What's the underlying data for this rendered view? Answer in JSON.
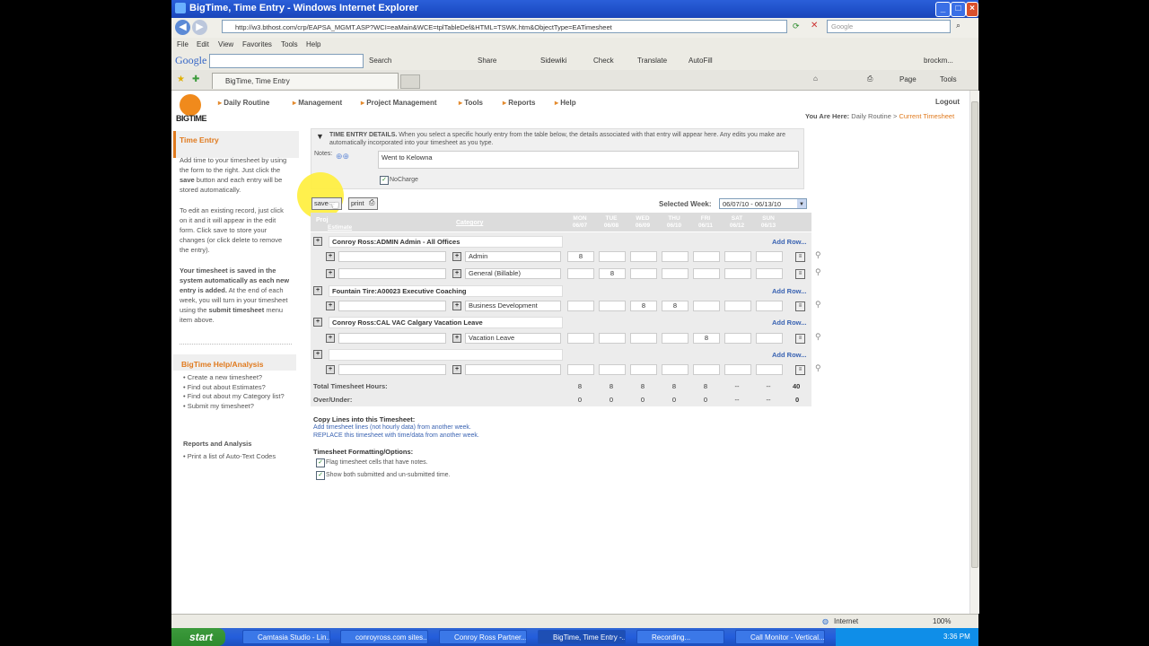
{
  "window": {
    "title": "BigTime, Time Entry - Windows Internet Explorer"
  },
  "browser": {
    "address": "http://w3.bthost.com/crp/EAPSA_MGMT.ASP?WCI=eaMain&WCE=tplTableDef&HTML=TSWK.htm&ObjectType=EATimesheet",
    "search_placeholder": "Google",
    "menu": [
      "File",
      "Edit",
      "View",
      "Favorites",
      "Tools",
      "Help"
    ],
    "google_label": "Google",
    "google_toolbar": [
      "Search",
      "Share",
      "Sidewiki",
      "Check",
      "Translate",
      "AutoFill"
    ],
    "google_user": "brockm...",
    "tab_title": "BigTime, Time Entry",
    "command_bar": [
      "Page",
      "Tools"
    ]
  },
  "app": {
    "logo": "BIGTIME",
    "nav": [
      "Daily Routine",
      "Management",
      "Project Management",
      "Tools",
      "Reports",
      "Help"
    ],
    "logout": "Logout",
    "breadcrumb": {
      "prefix": "You Are Here:",
      "crumb1": "Daily Routine",
      "sep": ">",
      "current": "Current Timesheet"
    }
  },
  "sidebar": {
    "title": "Time Entry",
    "p1a": "Add time to your timesheet by using the form to the right. Just click the",
    "p1b": "save",
    "p1c": "button and each entry will be stored automatically.",
    "p2": "To edit an existing record, just click on it and it will appear in the edit form. Click save to store your changes (or click delete to remove the entry).",
    "p3a": "Your timesheet is saved in the system automatically as each new entry is added.",
    "p3b": "At the end of each week, you will turn in your timesheet using the",
    "p3c": "submit timesheet",
    "p3d": "menu item above.",
    "help_title": "BigTime Help/Analysis",
    "help_links": [
      "Create a new timesheet?",
      "Find out about Estimates?",
      "Find out about my Category list?",
      "Submit my timesheet?"
    ],
    "reports_title": "Reports and Analysis",
    "reports_links": [
      "Print a list of Auto-Text Codes"
    ]
  },
  "details": {
    "heading": "TIME ENTRY DETAILS.",
    "text": "When you select a specific hourly entry from the table below, the details associated with that entry will appear here. Any edits you make are automatically incorporated into your timesheet as you type.",
    "notes_label": "Notes:",
    "notes_value": "Went to Kelowna",
    "nocharge_label": "NoCharge"
  },
  "toolbar": {
    "save": "save",
    "print": "print",
    "week_label": "Selected Week:",
    "week_value": "06/07/10 - 06/13/10"
  },
  "grid": {
    "col_project": "Proj",
    "col_estimate": "Estimate",
    "col_category": "Category",
    "days": [
      {
        "name": "MON",
        "date": "06/07"
      },
      {
        "name": "TUE",
        "date": "06/08"
      },
      {
        "name": "WED",
        "date": "06/09"
      },
      {
        "name": "THU",
        "date": "06/10"
      },
      {
        "name": "FRI",
        "date": "06/11"
      },
      {
        "name": "SAT",
        "date": "06/12"
      },
      {
        "name": "SUN",
        "date": "06/13"
      }
    ],
    "add_row": "Add Row...",
    "groups": [
      {
        "name": "Conroy Ross:ADMIN Admin - All Offices"
      },
      {
        "name": "Fountain Tire:A00023 Executive Coaching"
      },
      {
        "name": "Conroy Ross:CAL VAC Calgary Vacation Leave"
      },
      {
        "name": ""
      }
    ],
    "rows": [
      {
        "category": "Admin",
        "hours": [
          "8",
          "",
          "",
          "",
          "",
          "",
          ""
        ]
      },
      {
        "category": "General (Billable)",
        "hours": [
          "",
          "8",
          "",
          "",
          "",
          "",
          ""
        ]
      },
      {
        "category": "Business Development",
        "hours": [
          "",
          "",
          "8",
          "8",
          "",
          "",
          ""
        ]
      },
      {
        "category": "Vacation Leave",
        "hours": [
          "",
          "",
          "",
          "",
          "8",
          "",
          ""
        ]
      },
      {
        "category": "",
        "hours": [
          "",
          "",
          "",
          "",
          "",
          "",
          ""
        ]
      }
    ],
    "total_label": "Total Timesheet Hours:",
    "totals": [
      "8",
      "8",
      "8",
      "8",
      "8",
      "--",
      "--"
    ],
    "grand_total": "40",
    "over_label": "Over/Under:",
    "over": [
      "0",
      "0",
      "0",
      "0",
      "0",
      "--",
      "--"
    ],
    "over_total": "0"
  },
  "copy": {
    "title": "Copy Lines into this Timesheet:",
    "link1": "Add timesheet lines (not hourly data) from another week.",
    "link2": "REPLACE this timesheet with time/data from another week."
  },
  "options": {
    "title": "Timesheet Formatting/Options:",
    "opt1": "Flag timesheet cells that have notes.",
    "opt2": "Show both submitted and un-submitted time."
  },
  "status": {
    "zone": "Internet",
    "zoom": "100%"
  },
  "taskbar": {
    "start": "start",
    "tasks": [
      "Camtasia Studio - Lin...",
      "conroyross.com sites...",
      "Conroy Ross Partner...",
      "BigTime, Time Entry -...",
      "Recording...",
      "Call Monitor - Vertical..."
    ],
    "clock": "3:36 PM"
  }
}
